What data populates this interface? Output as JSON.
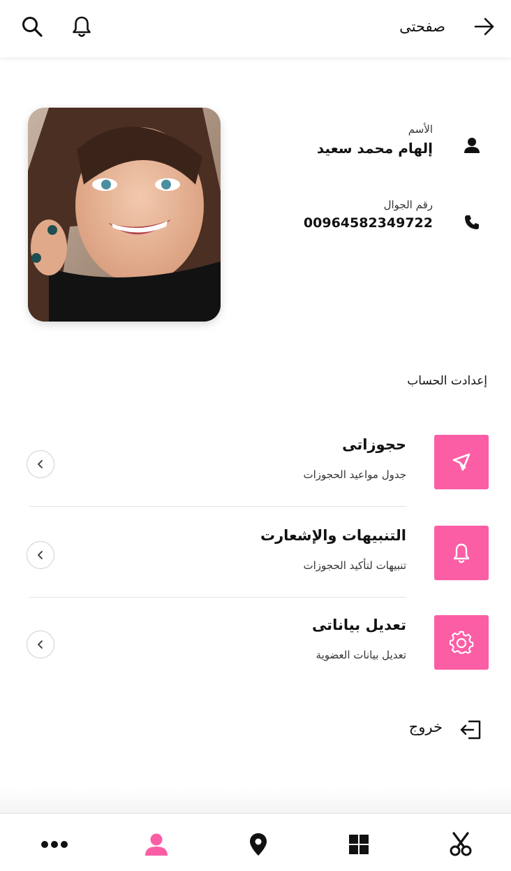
{
  "header": {
    "title": "صفحتى",
    "back_icon": "arrow-right-icon",
    "search_icon": "search-icon",
    "bell_icon": "bell-icon"
  },
  "profile": {
    "photo_icon": "avatar-photo",
    "name_label": "الأسم",
    "name_value": "إلهام محمد سعيد",
    "phone_label": "رقم الجوال",
    "phone_value": "00964582349722"
  },
  "settings": {
    "section_title": "إعدادت الحساب",
    "items": [
      {
        "title": "حجوزاتى",
        "subtitle": "جدول مواعيد الحجوزات",
        "icon": "cursor-icon"
      },
      {
        "title": "التنبيهات والإشعارت",
        "subtitle": "تنبيهات لتأكيد الحجوزات",
        "icon": "bell-icon"
      },
      {
        "title": "تعديل بياناتى",
        "subtitle": "تعديل بيانات العضوية",
        "icon": "gear-icon"
      }
    ]
  },
  "logout": {
    "label": "خروج",
    "icon": "logout-icon"
  },
  "bottom_nav": {
    "items": [
      "more-dots-icon",
      "profile-icon",
      "location-pin-icon",
      "grid-icon",
      "scissors-icon"
    ],
    "active": "profile-icon"
  },
  "colors": {
    "accent": "#fb5ea5",
    "text": "#111111",
    "muted": "#333333"
  }
}
